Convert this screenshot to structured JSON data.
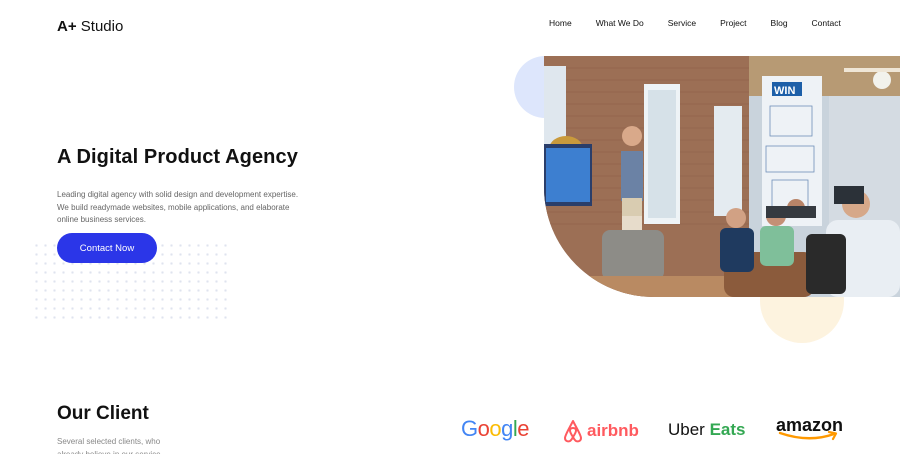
{
  "header": {
    "brand_prefix": "A+",
    "brand_name": "Studio",
    "nav": [
      "Home",
      "What We Do",
      "Service",
      "Project",
      "Blog",
      "Contact"
    ]
  },
  "hero": {
    "title": "A Digital Product Agency",
    "description": "Leading digital agency with solid design and development expertise. We build readymade websites, mobile applications, and elaborate online business services.",
    "cta_label": "Contact Now",
    "photo_sign_text": "WIN"
  },
  "clients": {
    "title": "Our Client",
    "description": "Several selected clients, who already believe in our service.",
    "logos": {
      "google": [
        "G",
        "o",
        "o",
        "g",
        "l",
        "e"
      ],
      "airbnb": "airbnb",
      "uber": "Uber",
      "eats": "Eats",
      "amazon": "amazon"
    }
  },
  "colors": {
    "accent": "#2b36e8",
    "google": [
      "#4285F4",
      "#EA4335",
      "#FBBC05",
      "#4285F4",
      "#34A853",
      "#EA4335"
    ],
    "airbnb": "#ff5a5f",
    "uber_eats": "#34a853",
    "amazon_smile": "#ff9900"
  }
}
